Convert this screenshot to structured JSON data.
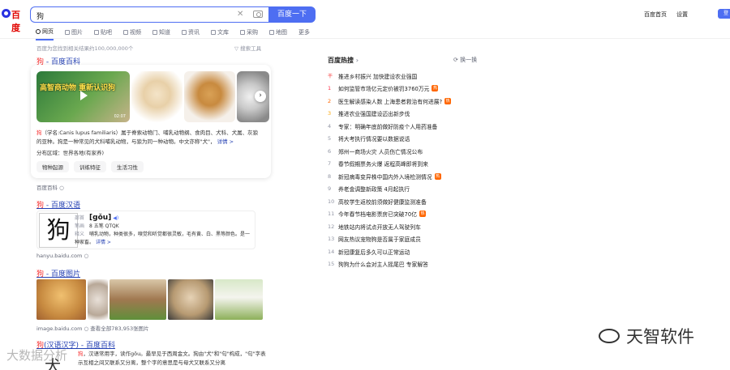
{
  "header": {
    "logo_text": "百度",
    "query": "狗",
    "search_button": "百度一下",
    "top_links": [
      "百度首页",
      "设置"
    ],
    "user_button": "登"
  },
  "tabs": [
    {
      "label": "网页",
      "active": true
    },
    {
      "label": "图片"
    },
    {
      "label": "贴吧"
    },
    {
      "label": "视频"
    },
    {
      "label": "知道"
    },
    {
      "label": "资讯"
    },
    {
      "label": "文库"
    },
    {
      "label": "采购"
    },
    {
      "label": "地图"
    },
    {
      "label": "更多"
    }
  ],
  "result_count": "百度为您找到相关结果约100,000,000个",
  "search_tools": "搜索工具",
  "result1": {
    "title_hl": "狗",
    "title_rest": " - 百度百科",
    "video_title": "高智商动物 重新认识狗",
    "video_duration": "02:07",
    "desc_hl": "狗",
    "desc": "（学名:Canis lupus familiaris）属于脊索动物门、哺乳动物纲、食肉目、犬科、犬属、灰狼的亚种。狗是一种常见的犬科哺乳动物，与狼为同一种动物。中文亦称\"犬\"，",
    "desc_more": "详情 >",
    "meta": "分布区域：世界各地(有家养)",
    "chips": [
      "物种起源",
      "训练特征",
      "生活习性"
    ],
    "source": "百度百科"
  },
  "result2": {
    "title_hl": "狗",
    "title_rest": " - 百度汉语",
    "char": "狗",
    "pinyin": "[gǒu]",
    "rows": [
      {
        "label": "部首",
        "value": "犭"
      },
      {
        "label": "笔画",
        "value": "8    五笔  QTQK"
      },
      {
        "label": "释义",
        "value": "哺乳动物，种类很多，嗅觉和听觉都很灵敏，毛有黄、白、黑等颜色。是一种家畜。"
      }
    ],
    "more": "详情 >",
    "source": "hanyu.baidu.com"
  },
  "result3": {
    "title_hl": "狗",
    "title_rest": " - 百度图片",
    "source": "image.baidu.com",
    "source_extra": "查看全部783,953张图片"
  },
  "result4": {
    "title_hl": "狗",
    "title_rest": "(汉语汉字) - 百度百科",
    "char": "犬",
    "desc_hl": "狗",
    "desc": "，汉语常用字，读作gǒu。最早见于西周金文。狗由\"犬\"和\"句\"构成，\"句\"字表示互相之间又联系又分离，整个字的意思是与母犬又联系又分离"
  },
  "hot": {
    "title": "百度热搜",
    "refresh": "换一换",
    "items": [
      {
        "num": "置顶",
        "text": "推进乡村振兴 加快建设农业强国",
        "badge": false
      },
      {
        "num": "1",
        "text": "如何监管市场亿元定价被罚3760万元",
        "badge": true
      },
      {
        "num": "2",
        "text": "医生解读感染人数 上海患者救治有何进展?",
        "badge": true
      },
      {
        "num": "3",
        "text": "推进农业强国建设迈出新步伐",
        "badge": false
      },
      {
        "num": "4",
        "text": "专家：明确年底前做好防疫个人用药准备",
        "badge": false
      },
      {
        "num": "5",
        "text": "将大考执行情况要以数据说话",
        "badge": false
      },
      {
        "num": "6",
        "text": "郑州一商场火灾 人员伤亡情况公布",
        "badge": false
      },
      {
        "num": "7",
        "text": "春节假期票务火爆 返程高峰即将到来",
        "badge": false
      },
      {
        "num": "8",
        "text": "新冠病毒变异株中国内外入境检测情况",
        "badge": true
      },
      {
        "num": "9",
        "text": "养老金调整新政策 4月起执行",
        "badge": false
      },
      {
        "num": "10",
        "text": "高校学生返校前须做好健康监测准备",
        "badge": false
      },
      {
        "num": "11",
        "text": "今年春节档电影票房已突破70亿",
        "badge": true
      },
      {
        "num": "12",
        "text": "地铁站内将试点开放无人驾驶列车",
        "badge": false
      },
      {
        "num": "13",
        "text": "网友热议宠物狗是否属于家庭成员",
        "badge": false
      },
      {
        "num": "14",
        "text": "新冠康复后多久可以正常运动",
        "badge": false
      },
      {
        "num": "15",
        "text": "狗狗为什么会对主人摇尾巴 专家解答",
        "badge": false
      }
    ]
  },
  "watermarks": {
    "brand": "天智软件",
    "corner": "大数据分析"
  }
}
